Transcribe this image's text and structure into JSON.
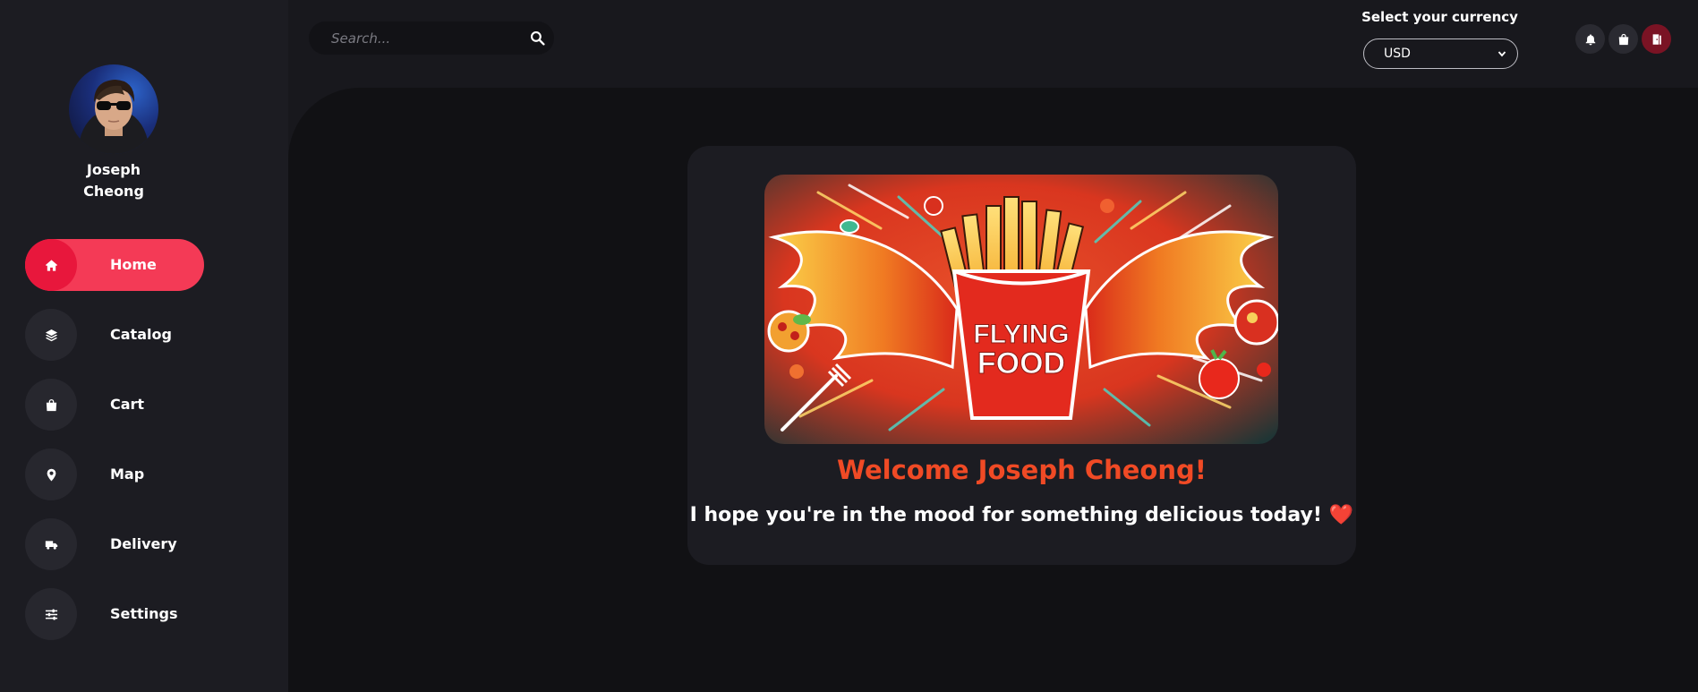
{
  "user": {
    "first_name": "Joseph",
    "last_name": "Cheong"
  },
  "sidebar": {
    "items": [
      {
        "label": "Home",
        "icon": "home-icon",
        "active": true
      },
      {
        "label": "Catalog",
        "icon": "layers-icon",
        "active": false
      },
      {
        "label": "Cart",
        "icon": "shopping-bag-icon",
        "active": false
      },
      {
        "label": "Map",
        "icon": "map-pin-icon",
        "active": false
      },
      {
        "label": "Delivery",
        "icon": "truck-icon",
        "active": false
      },
      {
        "label": "Settings",
        "icon": "sliders-icon",
        "active": false
      }
    ]
  },
  "search": {
    "placeholder": "Search...",
    "value": ""
  },
  "currency": {
    "label": "Select your currency",
    "selected": "USD"
  },
  "header_icons": [
    "bell-icon",
    "shopping-bag-icon",
    "logout-door-icon"
  ],
  "banner": {
    "logo_text": "FLYING FOOD"
  },
  "welcome": {
    "title": "Welcome Joseph Cheong!",
    "subtitle": "I hope you're in the mood for something delicious today!",
    "emoji": "❤️"
  },
  "colors": {
    "accent": "#f43a56",
    "accent_dark": "#e8173c",
    "welcome_title": "#f04a25",
    "logout_bg": "#7a1324",
    "sidebar_bg": "#1c1c22",
    "main_bg": "#111114",
    "card_bg": "#1c1c22"
  }
}
